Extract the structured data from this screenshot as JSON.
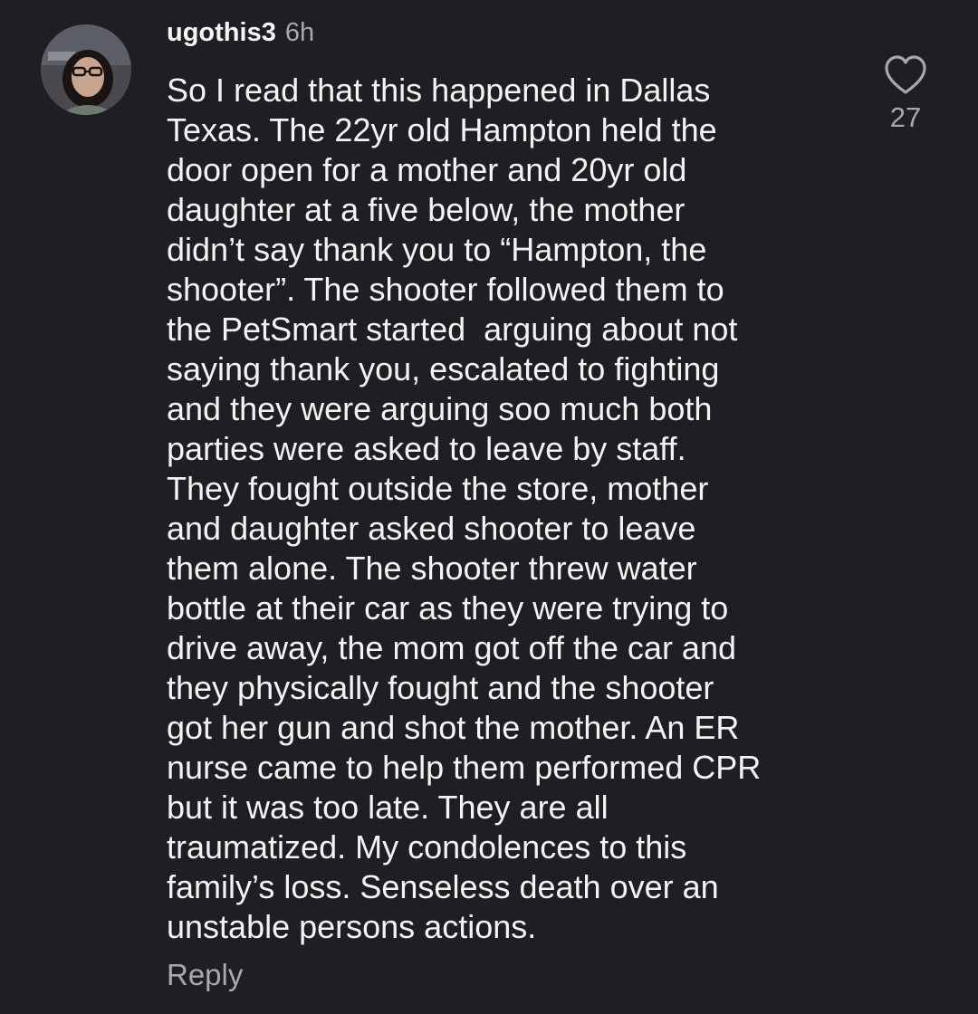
{
  "comment": {
    "username": "ugothis3",
    "time": "6h",
    "avatar_icon": "user-avatar-photo",
    "text_lines": [
      "So I read that this happened in Dallas",
      "Texas. The 22yr old Hampton held the",
      "door open for a mother and 20yr old",
      "daughter at a five below, the mother",
      "didn’t say thank you to “Hampton, the",
      "shooter”. The shooter followed them to",
      "the PetSmart started  arguing about not",
      "saying thank you, escalated to fighting",
      "and they were arguing soo much both",
      "parties were asked to leave by staff.",
      "They fought outside the store, mother",
      "and daughter asked shooter to leave",
      "them alone. The shooter threw water",
      "bottle at their car as they were trying to",
      "drive away, the mom got off the car and",
      "they physically fought and the shooter",
      "got her gun and shot the mother. An ER",
      "nurse came to help them performed CPR",
      "but it was too late. They are all",
      "traumatized. My condolences to this",
      "family’s loss. Senseless death over an",
      "unstable persons actions."
    ],
    "reply_label": "Reply",
    "like_icon": "heart-outline-icon",
    "like_count": "27"
  },
  "colors": {
    "background": "#1f1f23",
    "primary_text": "#f3f3f3",
    "secondary_text": "#a8a8ad"
  }
}
